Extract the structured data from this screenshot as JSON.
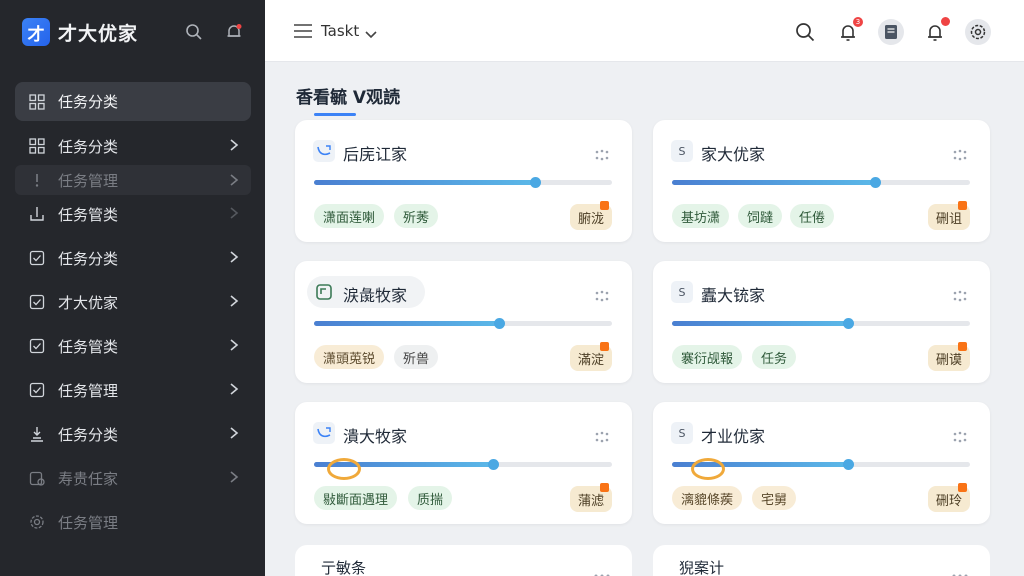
{
  "app": {
    "logo_char": "才",
    "title": "才大优家"
  },
  "sidebar": {
    "active_label": "任务分类",
    "items": [
      {
        "label": "任务分类",
        "icon": "grid-icon",
        "dim": false
      },
      {
        "label": "任务管理",
        "icon": "exclamation-icon",
        "dim": true
      },
      {
        "label": "任务管类",
        "icon": "download-icon",
        "dim": false
      },
      {
        "label": "任务分类",
        "icon": "checkbox-icon",
        "dim": false
      },
      {
        "label": "才大优家",
        "icon": "checkbox-icon",
        "dim": false
      },
      {
        "label": "任务管类",
        "icon": "checkbox-icon",
        "dim": false
      },
      {
        "label": "任务管理",
        "icon": "checkbox-icon",
        "dim": false
      },
      {
        "label": "任务分类",
        "icon": "recycle-icon",
        "dim": false
      },
      {
        "label": "寿贵任家",
        "icon": "calendar-icon",
        "dim": true
      },
      {
        "label": "任务管理",
        "icon": "gear-icon",
        "dim": true
      }
    ]
  },
  "header": {
    "tasks_label": "Taskt",
    "badges": {
      "bell1": "3"
    }
  },
  "main": {
    "page_title": "香看毓 V观読"
  },
  "cards": [
    {
      "icon_text": "",
      "title": "后庑讧家",
      "progress": 0.74,
      "tags": [
        [
          "潇面莲喇",
          "green"
        ],
        [
          "歽莠",
          "green"
        ]
      ],
      "corner": "腑泷"
    },
    {
      "icon_text": "S",
      "title": "家大优家",
      "progress": 0.68,
      "tags": [
        [
          "基坊潇",
          "green"
        ],
        [
          "饲躂",
          "green"
        ],
        [
          "任倦",
          "green"
        ]
      ],
      "corner": "硎诅"
    },
    {
      "icon_text": "",
      "title": "涙彘牧家",
      "progress": 0.62,
      "tags": [
        [
          "潇頭莵锐",
          "beige"
        ],
        [
          "歽兽",
          "gray"
        ]
      ],
      "corner": "滿淀"
    },
    {
      "icon_text": "S",
      "title": "蠹大铳家",
      "progress": 0.59,
      "tags": [
        [
          "褰衍觇報",
          "green"
        ],
        [
          "任务",
          "green"
        ]
      ],
      "corner": "硎谟"
    },
    {
      "icon_text": "",
      "title": "潰大牧家",
      "progress": 0.6,
      "tags": [
        [
          "敡斷面遇理",
          "green"
        ],
        [
          "质揣",
          "green"
        ]
      ],
      "corner": "蒲滤"
    },
    {
      "icon_text": "S",
      "title": "才业优家",
      "progress": 0.59,
      "tags": [
        [
          "漓貔條蒺",
          "beige"
        ],
        [
          "宅舅",
          "beige"
        ]
      ],
      "corner": "硎玲"
    }
  ],
  "partial_cards": [
    {
      "title": "亍敏条"
    },
    {
      "title": "猊案计"
    }
  ],
  "colors": {
    "accent": "#3b82f6",
    "sidebar_bg": "#25272c",
    "badge": "#ef4444"
  }
}
